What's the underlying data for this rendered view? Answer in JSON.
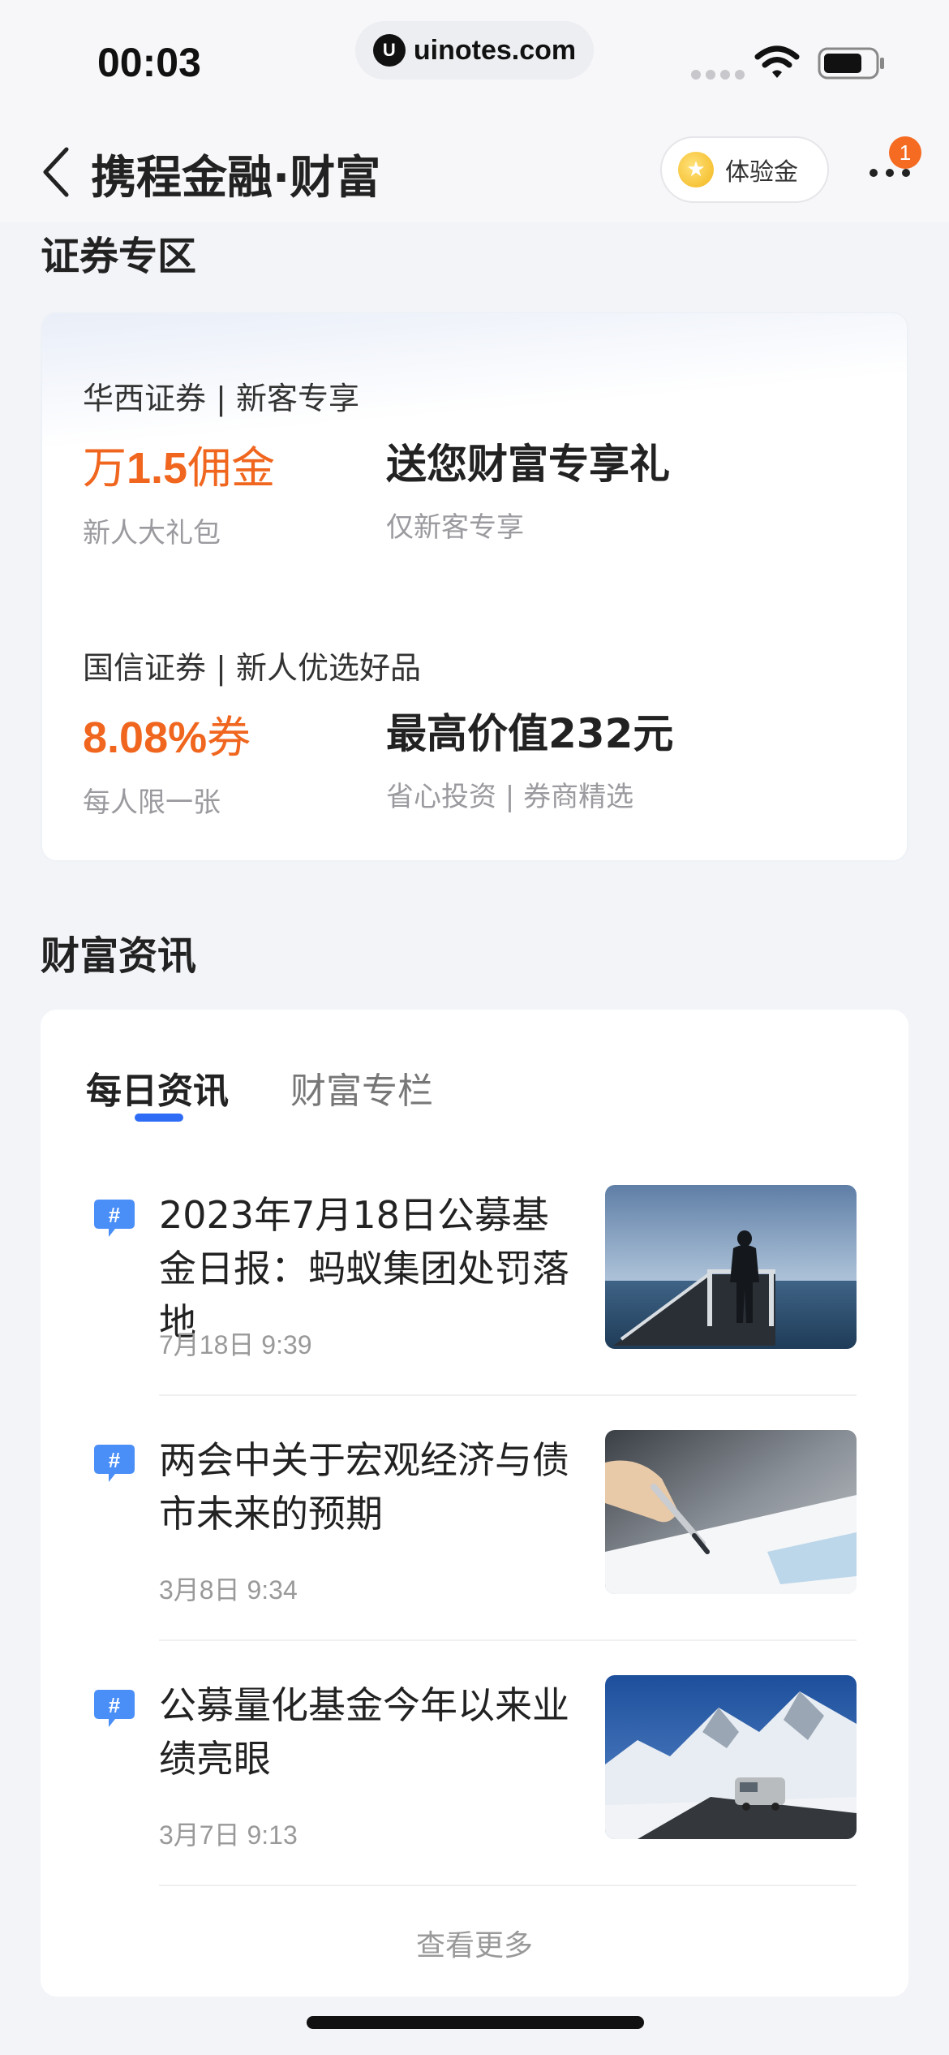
{
  "status_bar": {
    "time": "00:03",
    "url": "uinotes.com",
    "url_logo": "U"
  },
  "header": {
    "title": "携程金融·财富",
    "experience_label": "体验金",
    "coin_glyph": "★",
    "more_badge": "1"
  },
  "securities": {
    "section_title": "证券专区",
    "offers": [
      {
        "heading": "华西证券 | 新客专享",
        "left_prefix": "万",
        "left_value": "1.5",
        "left_suffix": "佣金",
        "left_sub": "新人大礼包",
        "right_title": "送您财富专享礼",
        "right_sub": "仅新客专享"
      },
      {
        "heading": "国信证券 | 新人优选好品",
        "left_prefix": "",
        "left_value": "8.08%",
        "left_suffix": "券",
        "left_sub": "每人限一张",
        "right_title": "最高价值232元",
        "right_sub": "省心投资 | 券商精选"
      }
    ]
  },
  "news": {
    "section_title": "财富资讯",
    "tabs": [
      {
        "label": "每日资讯",
        "active": true
      },
      {
        "label": "财富专栏",
        "active": false
      }
    ],
    "items": [
      {
        "title": "2023年7月18日公募基金日报：蚂蚁集团处罚落地",
        "time": "7月18日 9:39",
        "thumb": "man-on-pier-photo"
      },
      {
        "title": "两会中关于宏观经济与债市未来的预期",
        "time": "3月8日 9:34",
        "thumb": "hand-writing-photo"
      },
      {
        "title": "公募量化基金今年以来业绩亮眼",
        "time": "3月7日 9:13",
        "thumb": "snowy-road-van-photo"
      }
    ],
    "see_more": "查看更多"
  },
  "colors": {
    "accent_orange": "#f0661e",
    "tab_blue": "#2f6cf5",
    "hash_blue": "#4a8ef7",
    "badge_orange": "#f56b22"
  }
}
